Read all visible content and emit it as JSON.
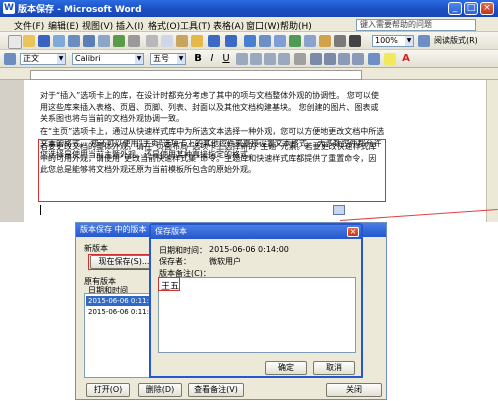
{
  "window": {
    "title": "版本保存 - Microsoft Word",
    "min": "_",
    "max": "□",
    "close": "×"
  },
  "menu": {
    "items": [
      "文件(F)",
      "编辑(E)",
      "视图(V)",
      "插入(I)",
      "格式(O)",
      "工具(T)",
      "表格(A)",
      "窗口(W)",
      "帮助(H)"
    ],
    "help_placeholder": "键入需要帮助的问题"
  },
  "toolbar": {
    "zoom": "100%",
    "read_mode": "阅读版式(R)",
    "style": "正文",
    "font": "Calibri",
    "size": "五号"
  },
  "document": {
    "paragraphs": [
      "对于“插入”选项卡上的库，在设计时都充分考虑了其中的项与文档整体外观的协调性。 您可以使用这些库来插入表格、页眉、页脚、列表、封面以及其他文档构建基块。 您创建的图片、图表或关系图也将与当前的文档外观协调一致。",
      "在“主页”选项卡上，通过从快速样式库中为所选文本选择一种外观，您可以方便地更改文档中所选文本的格式。 您还可以使用“主页”选项卡上的其他控件来直接设置文本格式。 大多数控件都允许您选择是使用当前主题外观，还是使用某种直接指定的格式。",
      "若要更改文档的整体外观，请在“页面布局”选项卡上选择新的“主题”元素。若要更改快速样式库中的可用外观，请使用“更改当前快速样式集”命令。主题库和快速样式库都提供了重置命令，因此您总是能够将文档外观还原为当前模板所包含的原始外观。"
    ]
  },
  "versions_dialog": {
    "title": "版本保存 中的版本",
    "new_versions_label": "新版本",
    "save_now_button": "现在保存(S)...",
    "existing_versions_label": "原有版本",
    "date_time_header": "日期和时间",
    "versions": [
      "2015-06-06 0:11:0",
      "2015-06-06 0:11:0"
    ],
    "open_button": "打开(O)",
    "delete_button": "删除(D)",
    "view_notes_button": "查看备注(V)",
    "close_button": "关闭"
  },
  "save_version_dialog": {
    "title": "保存版本",
    "date_time_label": "日期和时间：",
    "date_time_value": "2015-06-06 0:14:00",
    "saved_by_label": "保存者：",
    "saved_by_value": "微软用户",
    "notes_label": "版本备注(C)：",
    "notes_value": "王五",
    "ok_button": "确定",
    "cancel_button": "取消"
  },
  "colors": {
    "title_blue": "#2458cc",
    "highlight_red": "#d23030",
    "chrome": "#ece9d8"
  }
}
